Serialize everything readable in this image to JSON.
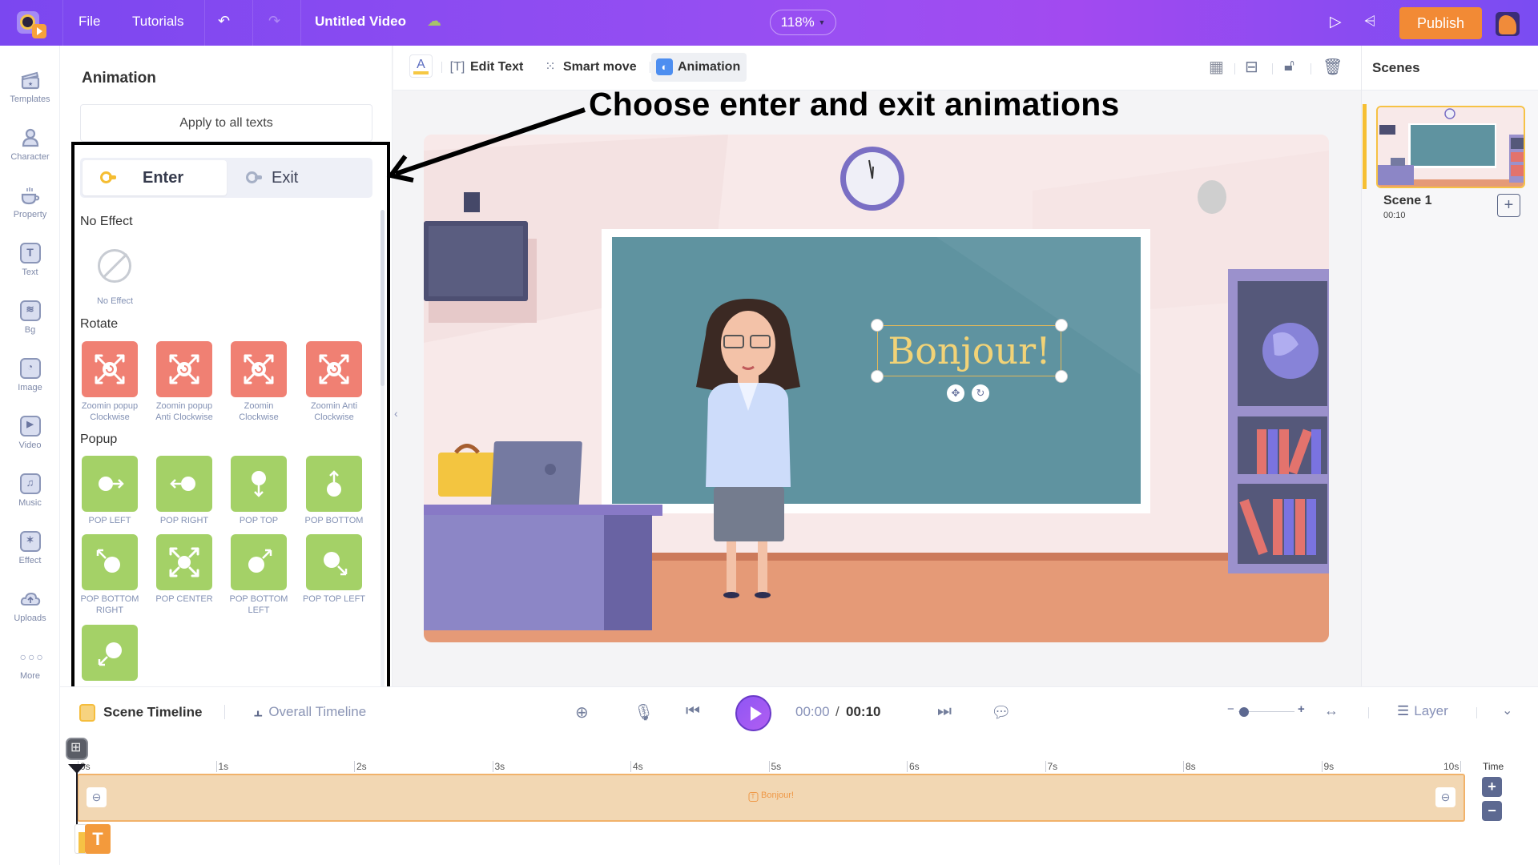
{
  "topbar": {
    "menu": [
      "File",
      "Tutorials"
    ],
    "project_title": "Untitled Video",
    "zoom_level": "118%",
    "publish_label": "Publish",
    "icons": {
      "undo": "undo-icon",
      "redo": "redo-icon",
      "cloud_saved": "cloud-saved-icon",
      "preview": "play-outline-icon",
      "share": "share-icon"
    }
  },
  "sidebar": {
    "items": [
      {
        "label": "Templates",
        "icon": "clapperboard-icon"
      },
      {
        "label": "Character",
        "icon": "person-icon"
      },
      {
        "label": "Property",
        "icon": "cup-icon"
      },
      {
        "label": "Text",
        "icon": "text-icon"
      },
      {
        "label": "Bg",
        "icon": "layers-icon"
      },
      {
        "label": "Image",
        "icon": "image-icon"
      },
      {
        "label": "Video",
        "icon": "video-icon"
      },
      {
        "label": "Music",
        "icon": "music-icon"
      },
      {
        "label": "Effect",
        "icon": "sparkle-icon"
      },
      {
        "label": "Uploads",
        "icon": "cloud-upload-icon"
      },
      {
        "label": "More",
        "icon": "more-dots-icon"
      }
    ]
  },
  "panel": {
    "title": "Animation",
    "apply_all_label": "Apply to all texts",
    "tabs": [
      {
        "label": "Enter",
        "active": true
      },
      {
        "label": "Exit",
        "active": false
      }
    ],
    "sections": {
      "no_effect": {
        "title": "No Effect",
        "item_label": "No Effect"
      },
      "rotate": {
        "title": "Rotate",
        "items": [
          {
            "label_line1": "Zoomin popup",
            "label_line2": "Clockwise"
          },
          {
            "label_line1": "Zoomin popup",
            "label_line2": "Anti Clockwise"
          },
          {
            "label_line1": "Zoomin",
            "label_line2": "Clockwise"
          },
          {
            "label_line1": "Zoomin Anti",
            "label_line2": "Clockwise"
          }
        ]
      },
      "popup": {
        "title": "Popup",
        "items": [
          {
            "label_line1": "POP LEFT",
            "label_line2": ""
          },
          {
            "label_line1": "POP RIGHT",
            "label_line2": ""
          },
          {
            "label_line1": "POP TOP",
            "label_line2": ""
          },
          {
            "label_line1": "POP BOTTOM",
            "label_line2": ""
          },
          {
            "label_line1": "POP BOTTOM",
            "label_line2": "RIGHT"
          },
          {
            "label_line1": "POP CENTER",
            "label_line2": ""
          },
          {
            "label_line1": "POP BOTTOM",
            "label_line2": "LEFT"
          },
          {
            "label_line1": "POP TOP LEFT",
            "label_line2": ""
          },
          {
            "label_line1": "",
            "label_line2": ""
          }
        ]
      }
    }
  },
  "editor_toolbar": {
    "text_color_label": "A",
    "edit_text_label": "Edit Text",
    "smart_move_label": "Smart move",
    "animation_label": "Animation",
    "colors": {
      "text_color_swatch": "#f6c843",
      "animation_accent": "#4d8ef0"
    }
  },
  "annotation": {
    "text": "Choose enter and exit animations"
  },
  "canvas": {
    "selected_text": "Bonjour!",
    "colors": {
      "board": "#5f93a0",
      "text": "#f2d377",
      "wall": "#f8e9e9",
      "floor": "#e59a77"
    }
  },
  "scenes": {
    "title": "Scenes",
    "items": [
      {
        "name": "Scene 1",
        "duration": "00:10"
      }
    ],
    "add_label": "+"
  },
  "timeline": {
    "tabs": [
      {
        "label": "Scene Timeline",
        "active": true
      },
      {
        "label": "Overall Timeline",
        "active": false
      }
    ],
    "current_time": "00:00",
    "separator": "/",
    "total_time": "00:10",
    "zoom_slider_fraction": 0.1,
    "layer_label": "Layer",
    "ruler_ticks": [
      "0s",
      "1s",
      "2s",
      "3s",
      "4s",
      "5s",
      "6s",
      "7s",
      "8s",
      "9s",
      "10s"
    ],
    "track_label": "Bonjour!",
    "time_label": "Time",
    "time_plus": "+",
    "time_minus": "−",
    "text_layer_icon": "T"
  }
}
